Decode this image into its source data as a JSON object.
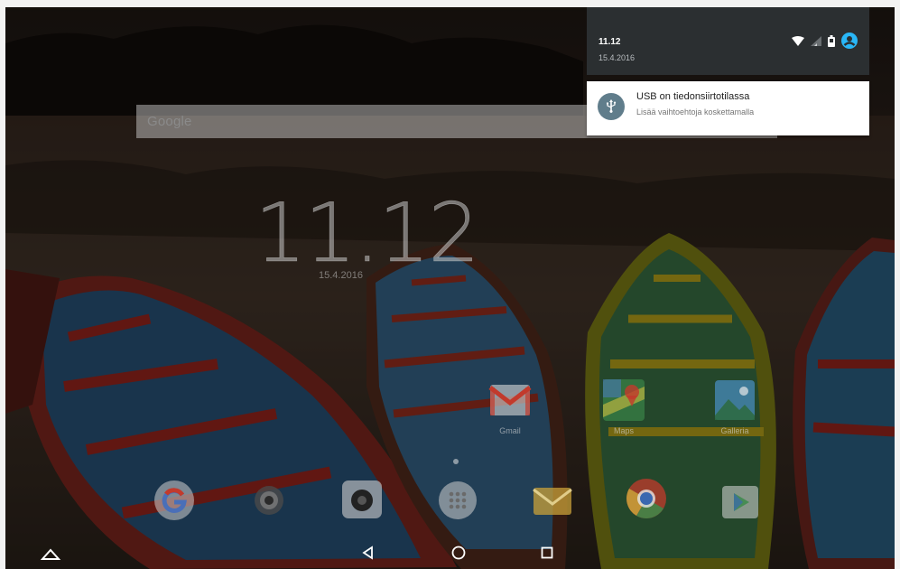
{
  "search": {
    "logo_text": "Google"
  },
  "clock": {
    "time": "11.12",
    "date": "15.4.2016"
  },
  "status_bar": {
    "time": "11.12",
    "date": "15.4.2016",
    "icons": [
      "wifi-icon",
      "signal-icon",
      "battery-icon",
      "account-icon"
    ]
  },
  "notification": {
    "icon": "usb-icon",
    "title": "USB on tiedonsiirtotilassa",
    "subtitle": "Lisää vaihtoehtoja koskettamalla"
  },
  "home_apps": [
    {
      "name": "gmail",
      "label": "Gmail",
      "color": "#ffffff"
    },
    {
      "name": "maps",
      "label": "Maps",
      "color": "#4caf50"
    },
    {
      "name": "gallery",
      "label": "Galleria",
      "color": "#64b5f6"
    }
  ],
  "dock": [
    "google-icon",
    "camera-icon",
    "camera-app-icon",
    "app-drawer-icon",
    "email-icon",
    "chrome-icon",
    "play-store-icon"
  ],
  "nav": [
    "home-up-icon",
    "back-icon",
    "home-icon",
    "recents-icon"
  ],
  "colors": {
    "shade": "#2b2f31",
    "notification_icon_bg": "#607d8b",
    "account_blue": "#29b6f6"
  }
}
